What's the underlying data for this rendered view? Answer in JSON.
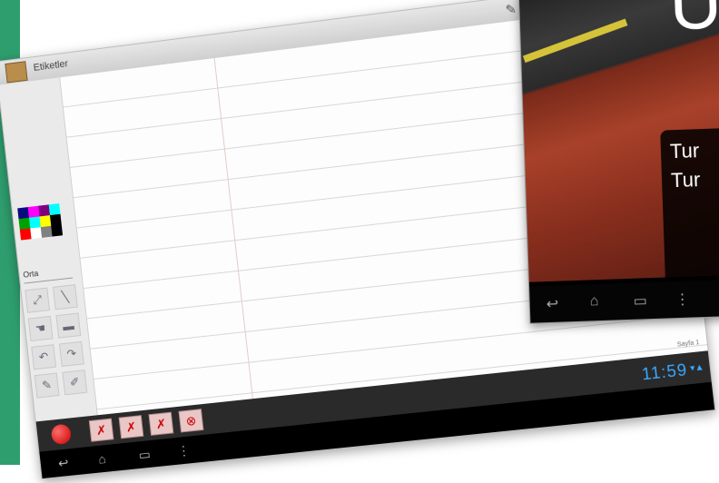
{
  "tablet1": {
    "title": "Etiketler",
    "size_select": "Orta",
    "page_indicator": "Sayfa 1",
    "clock": "11:59",
    "status_icons": "▾▲"
  },
  "tablet2": {
    "big_letter": "U",
    "subtitle_lines": [
      "Tur",
      "Tur"
    ]
  },
  "palette_colors": [
    "#0a0a80",
    "#ff00ff",
    "#800080",
    "#00ffff",
    "#00a000",
    "#00ffff",
    "#ffff00",
    "#000000",
    "#ff0000",
    "#ffffff",
    "#808080",
    "#000000"
  ],
  "colors": {
    "accent_green": "#2e9e6e",
    "clock_blue": "#3aa8ff",
    "record_red": "#c40000"
  }
}
